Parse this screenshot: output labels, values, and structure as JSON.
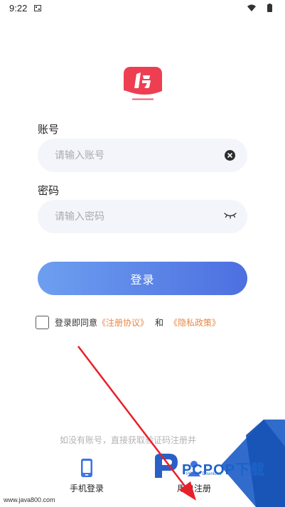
{
  "status_bar": {
    "time": "9:22"
  },
  "form": {
    "account_label": "账号",
    "account_placeholder": "请输入账号",
    "password_label": "密码",
    "password_placeholder": "请输入密码",
    "login_label": "登录"
  },
  "agreement": {
    "prefix": "登录即同意",
    "terms_link": "《注册协议》",
    "and": "和",
    "privacy_link": "《隐私政策》"
  },
  "footer": {
    "hint": "如没有账号，直接获取验证码注册并",
    "tabs": [
      {
        "label": "手机登录",
        "icon": "phone-icon"
      },
      {
        "label": "用户注册",
        "icon": "user-register-icon"
      }
    ]
  },
  "watermarks": {
    "site": "www.java800.com",
    "brand": "PCPOP下载",
    "brand_sub": "PCPOP Download"
  },
  "colors": {
    "primary_start": "#6d9ff0",
    "primary_end": "#4d6fe0",
    "link": "#e8874a",
    "input_bg": "#f4f5fa",
    "logo_red": "#ee3e52"
  }
}
